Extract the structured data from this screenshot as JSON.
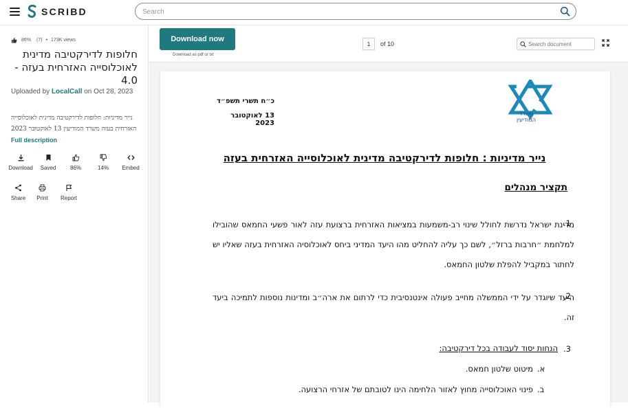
{
  "header": {
    "brand": "SCRIBD",
    "search_placeholder": "Search",
    "accent_color": "#1f7a80"
  },
  "sidebar": {
    "rating_percent": "86%",
    "rating_count": "(7)",
    "views": "173K views",
    "title": "חלופות לדירקטיבה מדינית לאוכלוסייה האזרחית בעזה - 4.0",
    "uploaded_prefix": "Uploaded by",
    "uploader": "LocalCall",
    "uploaded_suffix": "on Oct 28, 2023",
    "description": "נייר מדיניות: חלופות לדירקטיבה מדינית לאוכלוסייה האזרחית בעזה משרד המודיעין 13 לאוקטובר 2023",
    "full_description_link": "Full description",
    "actions": [
      {
        "icon": "download-icon",
        "label": "Download"
      },
      {
        "icon": "bookmark-icon",
        "label": "Saved"
      },
      {
        "icon": "thumbs-up-icon",
        "label": "86%"
      },
      {
        "icon": "thumbs-down-icon",
        "label": "14%"
      },
      {
        "icon": "embed-icon",
        "label": "Embed"
      }
    ],
    "actions2": [
      {
        "icon": "share-icon",
        "label": "Share"
      },
      {
        "icon": "print-icon",
        "label": "Print"
      },
      {
        "icon": "flag-icon",
        "label": "Report"
      }
    ]
  },
  "viewer": {
    "download_button": "Download now",
    "download_sub": "Download as pdf or txt",
    "current_page": "1",
    "of_label": "of",
    "total_pages": "10",
    "search_placeholder": "Search document"
  },
  "document": {
    "emblem_text": "משרד המודיעין",
    "date_hebrew": "כ״ח תשרי תשפ״ד",
    "date_gregorian": "13 לאוקטובר 2023",
    "heading": "נייר מדיניות : חלופות לדירקטיבה מדינית לאוכלוסייה האזרחית בעזה",
    "subheading": "תקציר מנהלים",
    "p1_num": ".1",
    "p1": "מדינת ישראל נדרשת לחולל שינוי רב-משמעות במציאות האזרחית ברצועת עזה לאור פשעי החמאס שהובילו למלחמת ״חרבות ברזל״, לשם כך עליה להחליט מהו היעד המדיני ביחס לאוכלוסיה האזרחית בעזה שאליו יש לחתור במקביל להפלת שלטון החמאס.",
    "p2_num": ".2",
    "p2": "היעד שיוגדר על ידי הממשלה מחייב פעולה אינטנסיבית כדי לרתום את ארה״ב ומדינות נוספות לתמיכה ביעד זה.",
    "p3_num": ".3",
    "p3_heading": "הנחות יסוד לעבודה בכל דירקטיבה:",
    "p3a_letter": "א.",
    "p3a": "מיטוט שלטון חמאס.",
    "p3b_letter": "ב.",
    "p3b": "פינוי האוכלוסייה מחוץ לאזור הלחימה הינו לטובתם של אזרחי הרצועה."
  }
}
